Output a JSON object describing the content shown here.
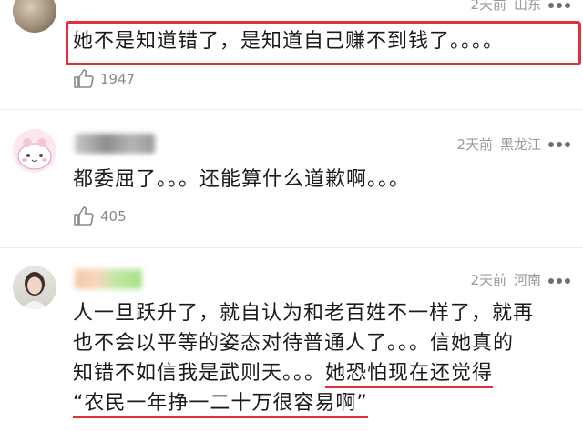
{
  "comments": [
    {
      "meta_time": "2天前",
      "meta_location": "山东",
      "text": "她不是知道错了，是知道自己赚不到钱了。。。。",
      "likes": "1947"
    },
    {
      "meta_time": "2天前",
      "meta_location": "黑龙江",
      "text": "都委屈了。。。还能算什么道歉啊。。。",
      "likes": "405"
    },
    {
      "meta_time": "2天前",
      "meta_location": "河南",
      "line1": "人一旦跃升了，就自认为和老百姓不一样了，就再",
      "line2": "也不会以平等的姿态对待普通人了。。。信她真的",
      "line3_plain": "知错不如信我是武则天。。。",
      "line3_underlined": "她恐怕现在还觉得",
      "line4_underlined": "“农民一年挣一二十万很容易啊”"
    }
  ],
  "colors": {
    "highlight": "#e0303a",
    "meta": "#9a9a9a"
  },
  "icons": [
    "more-icon",
    "thumbs-up-icon",
    "avatar"
  ]
}
